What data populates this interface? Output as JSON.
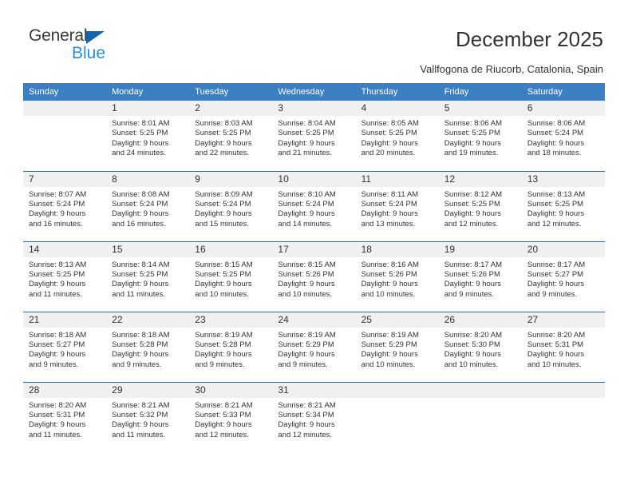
{
  "brand": {
    "name_top": "General",
    "name_bottom": "Blue",
    "accent_color": "#2a8fd8",
    "triangle_color": "#1565ad"
  },
  "header": {
    "title": "December 2025",
    "subtitle": "Vallfogona de Riucorb, Catalonia, Spain",
    "header_bg_color": "#3c7fc3",
    "row_divider_color": "#2f6fb0",
    "daynum_bg_color": "#f0f0f0"
  },
  "calendar": {
    "weekday_headers": [
      "Sunday",
      "Monday",
      "Tuesday",
      "Wednesday",
      "Thursday",
      "Friday",
      "Saturday"
    ],
    "weeks": [
      [
        {
          "day": "",
          "lines": []
        },
        {
          "day": "1",
          "lines": [
            "Sunrise: 8:01 AM",
            "Sunset: 5:25 PM",
            "Daylight: 9 hours",
            "and 24 minutes."
          ]
        },
        {
          "day": "2",
          "lines": [
            "Sunrise: 8:03 AM",
            "Sunset: 5:25 PM",
            "Daylight: 9 hours",
            "and 22 minutes."
          ]
        },
        {
          "day": "3",
          "lines": [
            "Sunrise: 8:04 AM",
            "Sunset: 5:25 PM",
            "Daylight: 9 hours",
            "and 21 minutes."
          ]
        },
        {
          "day": "4",
          "lines": [
            "Sunrise: 8:05 AM",
            "Sunset: 5:25 PM",
            "Daylight: 9 hours",
            "and 20 minutes."
          ]
        },
        {
          "day": "5",
          "lines": [
            "Sunrise: 8:06 AM",
            "Sunset: 5:25 PM",
            "Daylight: 9 hours",
            "and 19 minutes."
          ]
        },
        {
          "day": "6",
          "lines": [
            "Sunrise: 8:06 AM",
            "Sunset: 5:24 PM",
            "Daylight: 9 hours",
            "and 18 minutes."
          ]
        }
      ],
      [
        {
          "day": "7",
          "lines": [
            "Sunrise: 8:07 AM",
            "Sunset: 5:24 PM",
            "Daylight: 9 hours",
            "and 16 minutes."
          ]
        },
        {
          "day": "8",
          "lines": [
            "Sunrise: 8:08 AM",
            "Sunset: 5:24 PM",
            "Daylight: 9 hours",
            "and 16 minutes."
          ]
        },
        {
          "day": "9",
          "lines": [
            "Sunrise: 8:09 AM",
            "Sunset: 5:24 PM",
            "Daylight: 9 hours",
            "and 15 minutes."
          ]
        },
        {
          "day": "10",
          "lines": [
            "Sunrise: 8:10 AM",
            "Sunset: 5:24 PM",
            "Daylight: 9 hours",
            "and 14 minutes."
          ]
        },
        {
          "day": "11",
          "lines": [
            "Sunrise: 8:11 AM",
            "Sunset: 5:24 PM",
            "Daylight: 9 hours",
            "and 13 minutes."
          ]
        },
        {
          "day": "12",
          "lines": [
            "Sunrise: 8:12 AM",
            "Sunset: 5:25 PM",
            "Daylight: 9 hours",
            "and 12 minutes."
          ]
        },
        {
          "day": "13",
          "lines": [
            "Sunrise: 8:13 AM",
            "Sunset: 5:25 PM",
            "Daylight: 9 hours",
            "and 12 minutes."
          ]
        }
      ],
      [
        {
          "day": "14",
          "lines": [
            "Sunrise: 8:13 AM",
            "Sunset: 5:25 PM",
            "Daylight: 9 hours",
            "and 11 minutes."
          ]
        },
        {
          "day": "15",
          "lines": [
            "Sunrise: 8:14 AM",
            "Sunset: 5:25 PM",
            "Daylight: 9 hours",
            "and 11 minutes."
          ]
        },
        {
          "day": "16",
          "lines": [
            "Sunrise: 8:15 AM",
            "Sunset: 5:25 PM",
            "Daylight: 9 hours",
            "and 10 minutes."
          ]
        },
        {
          "day": "17",
          "lines": [
            "Sunrise: 8:15 AM",
            "Sunset: 5:26 PM",
            "Daylight: 9 hours",
            "and 10 minutes."
          ]
        },
        {
          "day": "18",
          "lines": [
            "Sunrise: 8:16 AM",
            "Sunset: 5:26 PM",
            "Daylight: 9 hours",
            "and 10 minutes."
          ]
        },
        {
          "day": "19",
          "lines": [
            "Sunrise: 8:17 AM",
            "Sunset: 5:26 PM",
            "Daylight: 9 hours",
            "and 9 minutes."
          ]
        },
        {
          "day": "20",
          "lines": [
            "Sunrise: 8:17 AM",
            "Sunset: 5:27 PM",
            "Daylight: 9 hours",
            "and 9 minutes."
          ]
        }
      ],
      [
        {
          "day": "21",
          "lines": [
            "Sunrise: 8:18 AM",
            "Sunset: 5:27 PM",
            "Daylight: 9 hours",
            "and 9 minutes."
          ]
        },
        {
          "day": "22",
          "lines": [
            "Sunrise: 8:18 AM",
            "Sunset: 5:28 PM",
            "Daylight: 9 hours",
            "and 9 minutes."
          ]
        },
        {
          "day": "23",
          "lines": [
            "Sunrise: 8:19 AM",
            "Sunset: 5:28 PM",
            "Daylight: 9 hours",
            "and 9 minutes."
          ]
        },
        {
          "day": "24",
          "lines": [
            "Sunrise: 8:19 AM",
            "Sunset: 5:29 PM",
            "Daylight: 9 hours",
            "and 9 minutes."
          ]
        },
        {
          "day": "25",
          "lines": [
            "Sunrise: 8:19 AM",
            "Sunset: 5:29 PM",
            "Daylight: 9 hours",
            "and 10 minutes."
          ]
        },
        {
          "day": "26",
          "lines": [
            "Sunrise: 8:20 AM",
            "Sunset: 5:30 PM",
            "Daylight: 9 hours",
            "and 10 minutes."
          ]
        },
        {
          "day": "27",
          "lines": [
            "Sunrise: 8:20 AM",
            "Sunset: 5:31 PM",
            "Daylight: 9 hours",
            "and 10 minutes."
          ]
        }
      ],
      [
        {
          "day": "28",
          "lines": [
            "Sunrise: 8:20 AM",
            "Sunset: 5:31 PM",
            "Daylight: 9 hours",
            "and 11 minutes."
          ]
        },
        {
          "day": "29",
          "lines": [
            "Sunrise: 8:21 AM",
            "Sunset: 5:32 PM",
            "Daylight: 9 hours",
            "and 11 minutes."
          ]
        },
        {
          "day": "30",
          "lines": [
            "Sunrise: 8:21 AM",
            "Sunset: 5:33 PM",
            "Daylight: 9 hours",
            "and 12 minutes."
          ]
        },
        {
          "day": "31",
          "lines": [
            "Sunrise: 8:21 AM",
            "Sunset: 5:34 PM",
            "Daylight: 9 hours",
            "and 12 minutes."
          ]
        },
        {
          "day": "",
          "lines": []
        },
        {
          "day": "",
          "lines": []
        },
        {
          "day": "",
          "lines": []
        }
      ]
    ]
  }
}
